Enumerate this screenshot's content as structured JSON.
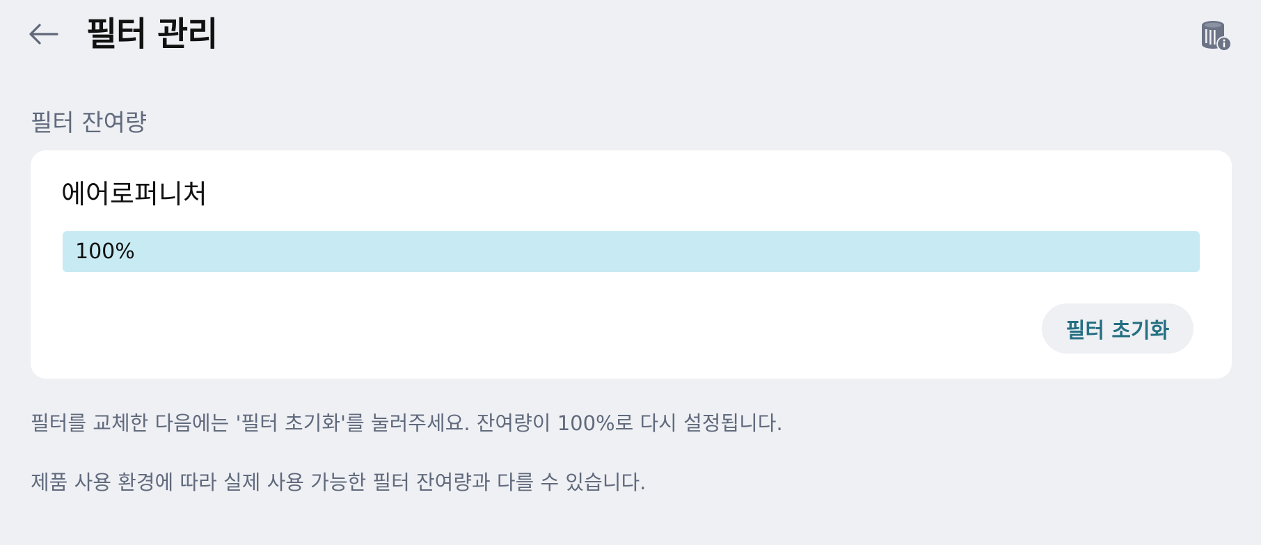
{
  "header": {
    "title": "필터 관리",
    "back_icon": "arrow-left-icon",
    "info_icon": "filter-info-icon"
  },
  "section": {
    "label": "필터 잔여량"
  },
  "filter_card": {
    "name": "에어로퍼니처",
    "remaining_text": "100%",
    "remaining_percent": 100,
    "reset_label": "필터 초기화"
  },
  "notes": [
    "필터를 교체한 다음에는 '필터 초기화'를 눌러주세요. 잔여량이 100%로 다시 설정됩니다.",
    "제품 사용 환경에 따라 실제 사용 가능한 필터 잔여량과 다를 수 있습니다."
  ],
  "colors": {
    "background": "#eff0f4",
    "progress_fill": "#c8eaf3",
    "accent_text": "#256f82",
    "secondary_text": "#606a7c"
  }
}
